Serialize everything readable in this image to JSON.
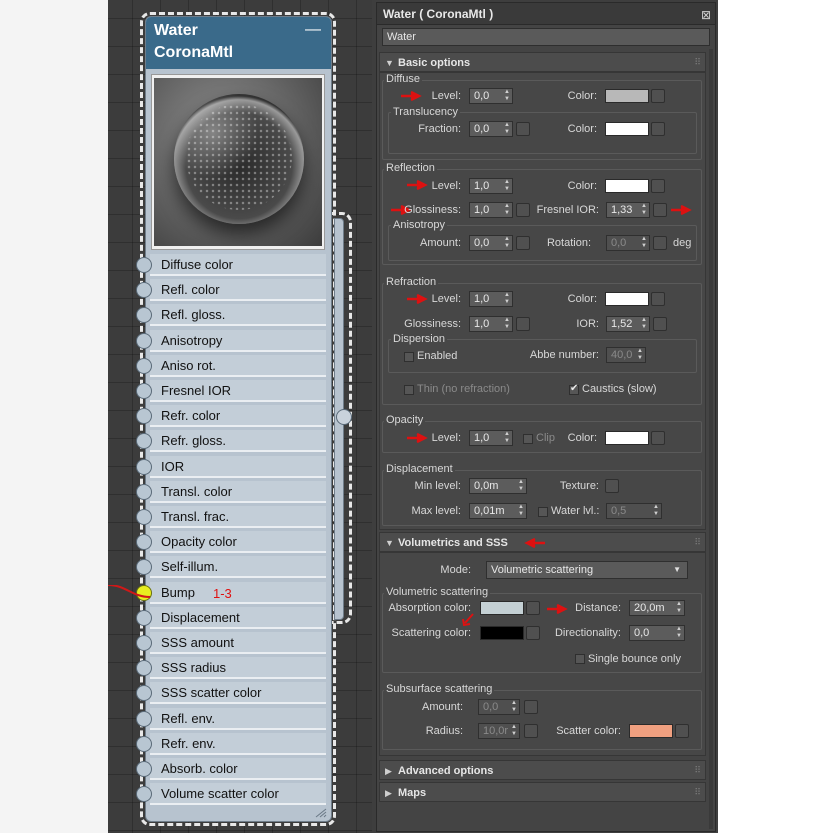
{
  "node": {
    "title_line1": "Water",
    "title_line2": "CoronaMtl",
    "minimize_glyph": "—",
    "slots": [
      "Diffuse color",
      "Refl. color",
      "Refl. gloss.",
      "Anisotropy",
      "Aniso rot.",
      "Fresnel IOR",
      "Refr. color",
      "Refr. gloss.",
      "IOR",
      "Transl. color",
      "Transl. frac.",
      "Opacity color",
      "Self-illum.",
      "Bump",
      "Displacement",
      "SSS amount",
      "SSS radius",
      "SSS scatter color",
      "Refl. env.",
      "Refr. env.",
      "Absorb. color",
      "Volume scatter color"
    ],
    "bump_note": "1-3",
    "active_slot": "Bump"
  },
  "panel": {
    "title": "Water  ( CoronaMtl )",
    "close_glyph": "⊠",
    "name_value": "Water",
    "basic": {
      "title": "Basic options",
      "diffuse": {
        "group": "Diffuse",
        "level_label": "Level:",
        "level": "0,0",
        "color_label": "Color:",
        "color": "#b8b8b8",
        "transl_group": "Translucency",
        "fraction_label": "Fraction:",
        "fraction": "0,0",
        "transl_color_label": "Color:",
        "transl_color": "#ffffff"
      },
      "reflection": {
        "group": "Reflection",
        "level_label": "Level:",
        "level": "1,0",
        "color_label": "Color:",
        "color": "#ffffff",
        "gloss_label": "Glossiness:",
        "gloss": "1,0",
        "fresnel_label": "Fresnel IOR:",
        "fresnel": "1,33",
        "aniso_group": "Anisotropy",
        "amount_label": "Amount:",
        "amount": "0,0",
        "rotation_label": "Rotation:",
        "rotation": "0,0",
        "deg": "deg"
      },
      "refraction": {
        "group": "Refraction",
        "level_label": "Level:",
        "level": "1,0",
        "color_label": "Color:",
        "color": "#ffffff",
        "gloss_label": "Glossiness:",
        "gloss": "1,0",
        "ior_label": "IOR:",
        "ior": "1,52",
        "disp_group": "Dispersion",
        "enabled_label": "Enabled",
        "abbe_label": "Abbe number:",
        "abbe": "40,0",
        "thin_label": "Thin (no refraction)",
        "caustics_label": "Caustics (slow)",
        "caustics_checked": true
      },
      "opacity": {
        "group": "Opacity",
        "level_label": "Level:",
        "level": "1,0",
        "clip_label": "Clip",
        "color_label": "Color:",
        "color": "#ffffff"
      },
      "displacement": {
        "group": "Displacement",
        "min_label": "Min level:",
        "min": "0,0m",
        "texture_label": "Texture:",
        "max_label": "Max level:",
        "max": "0,01m",
        "water_label": "Water lvl.:",
        "water": "0,5"
      }
    },
    "volumetrics": {
      "title": "Volumetrics and SSS",
      "mode_label": "Mode:",
      "mode": "Volumetric scattering",
      "vol_group": "Volumetric scattering",
      "absorption_label": "Absorption color:",
      "absorption_color": "#c4d0d4",
      "distance_label": "Distance:",
      "distance": "20,0m",
      "scattering_label": "Scattering color:",
      "scattering_color": "#000000",
      "directionality_label": "Directionality:",
      "directionality": "0,0",
      "single_bounce_label": "Single bounce only",
      "sss_group": "Subsurface scattering",
      "amount_label": "Amount:",
      "amount": "0,0",
      "radius_label": "Radius:",
      "radius": "10,0r",
      "scatter_label": "Scatter color:",
      "scatter_color": "#f0a080"
    },
    "advanced": {
      "title": "Advanced options"
    },
    "maps": {
      "title": "Maps"
    }
  },
  "colors": {
    "accent_red": "#dd1111",
    "node_header": "#3a6a8a",
    "node_body": "#b7c3cf"
  }
}
